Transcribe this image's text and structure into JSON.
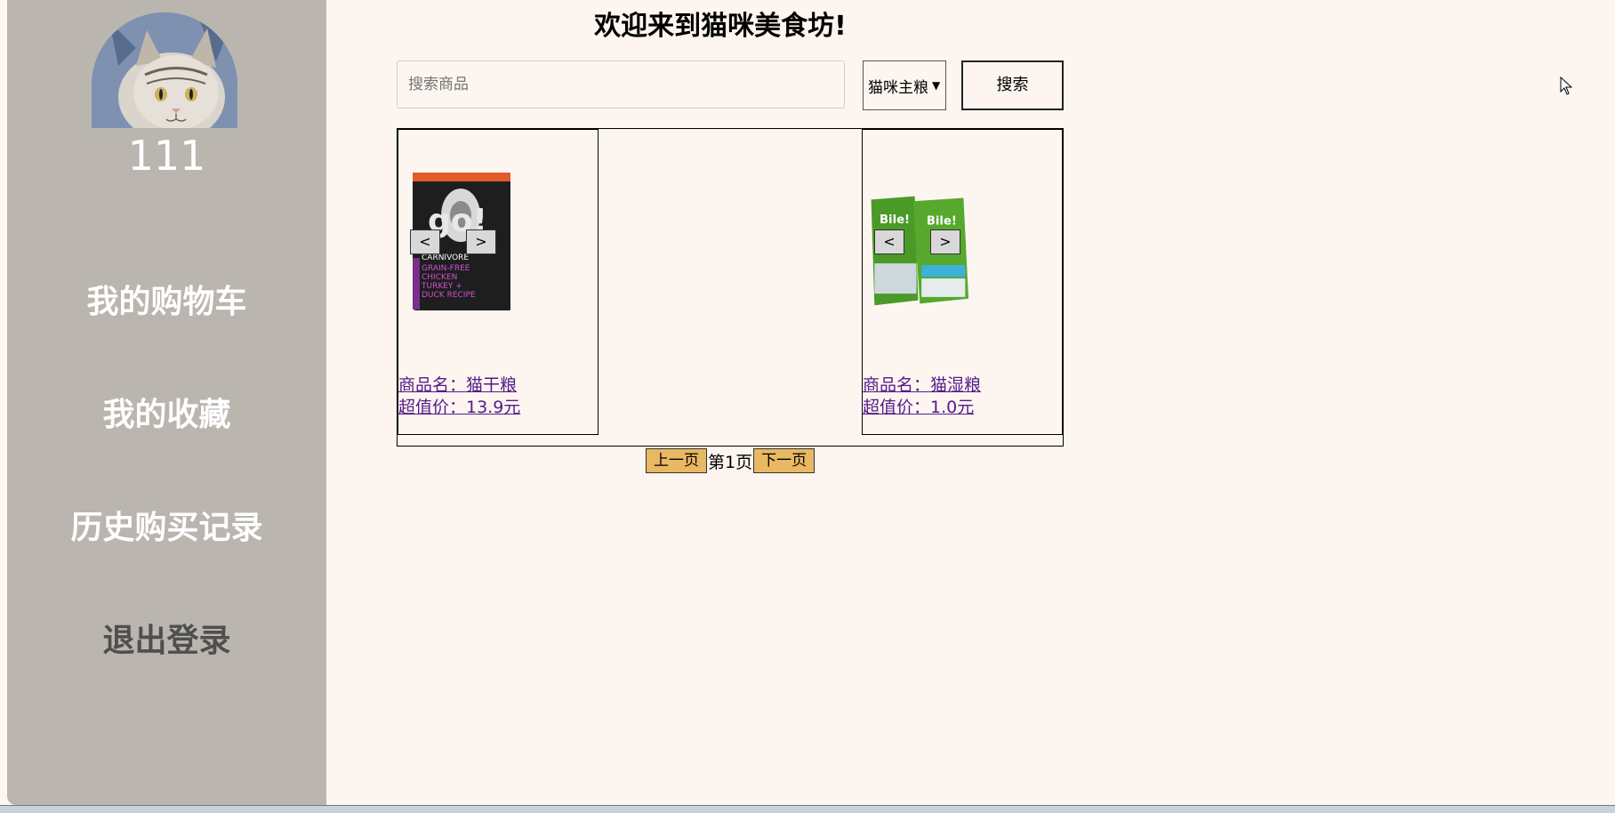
{
  "sidebar": {
    "username": "111",
    "menu": [
      {
        "label": "我的购物车"
      },
      {
        "label": "我的收藏"
      },
      {
        "label": "历史购买记录"
      },
      {
        "label": "退出登录"
      }
    ]
  },
  "header": {
    "title": "欢迎来到猫咪美食坊!"
  },
  "search": {
    "placeholder": "搜索商品",
    "value": "",
    "category_selected": "猫咪主粮",
    "button_label": "搜索"
  },
  "products": [
    {
      "name_line": "商品名：猫干粮",
      "price_line": "超值价：13.9元",
      "prev_label": "<",
      "next_label": ">",
      "image_icon": "cat-food-bag-image"
    },
    {
      "name_line": "商品名：猫湿粮",
      "price_line": "超值价：1.0元",
      "prev_label": "<",
      "next_label": ">",
      "image_icon": "wet-food-bags-image"
    }
  ],
  "pagination": {
    "prev_label": "上一页",
    "page_label": "第1页",
    "next_label": "下一页"
  },
  "colors": {
    "page_bg": "#fdf6f0",
    "sidebar_bg": "#bab5af",
    "page_button_bg": "#e9b862",
    "link": "#551a8b"
  }
}
